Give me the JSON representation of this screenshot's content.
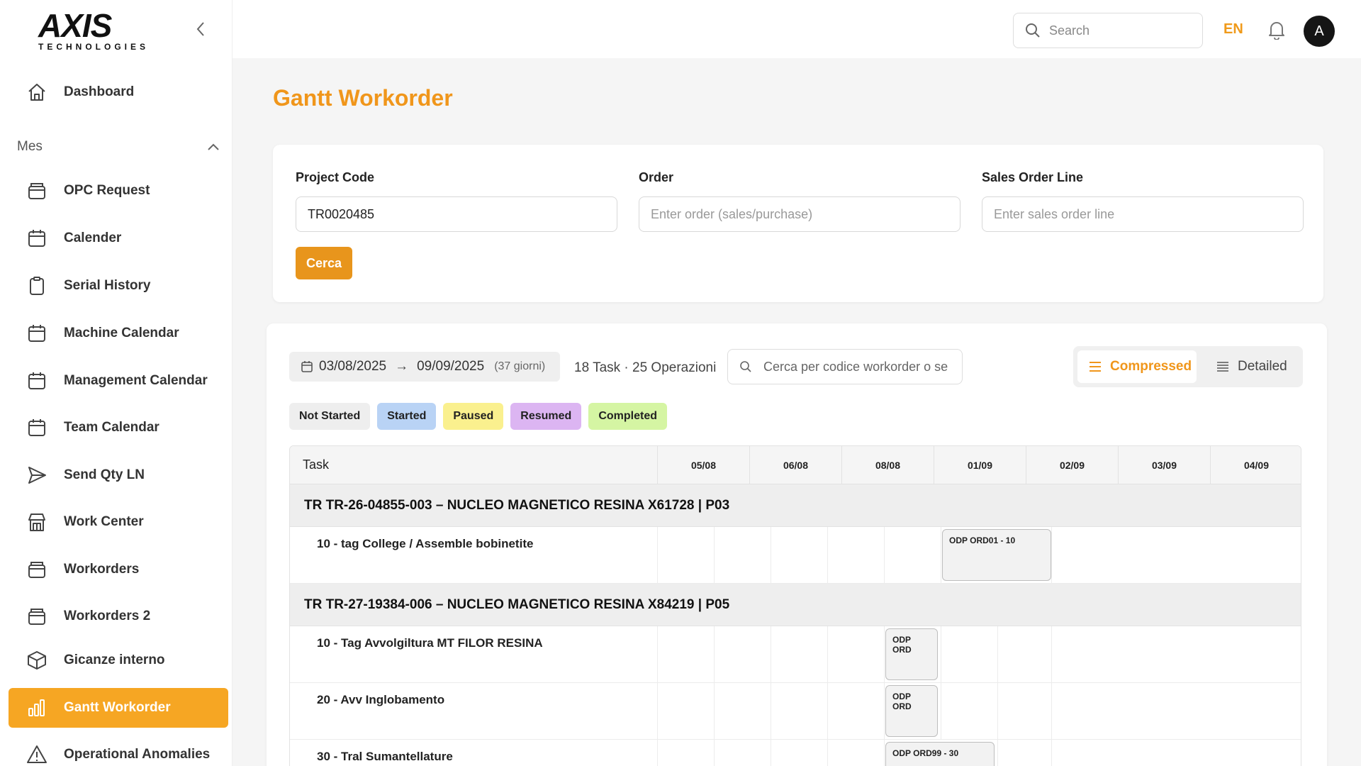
{
  "brand": {
    "name_main": "AXIS",
    "name_sub": "TECHNOLOGIES",
    "accent": "#f6a623",
    "logo_x_color": "#d32f2f"
  },
  "sidebar": {
    "dashboard": "Dashboard",
    "section": "Mes",
    "items": [
      {
        "label": "OPC Request",
        "icon": "box-icon"
      },
      {
        "label": "Calender",
        "icon": "calendar-icon"
      },
      {
        "label": "Serial History",
        "icon": "clipboard-icon"
      },
      {
        "label": "Machine Calendar",
        "icon": "calendar-icon"
      },
      {
        "label": "Management Calendar",
        "icon": "calendar-icon"
      },
      {
        "label": "Team Calendar",
        "icon": "calendar-icon"
      },
      {
        "label": "Send Qty LN",
        "icon": "send-icon"
      },
      {
        "label": "Work Center",
        "icon": "building-icon"
      },
      {
        "label": "Workorders",
        "icon": "box-icon"
      },
      {
        "label": "Workorders 2",
        "icon": "box-icon"
      },
      {
        "label": "Gicanze interno",
        "icon": "cube-icon"
      },
      {
        "label": "Gantt Workorder",
        "icon": "bar-chart-icon",
        "active": true
      },
      {
        "label": "Operational Anomalies",
        "icon": "warning-icon"
      }
    ]
  },
  "topbar": {
    "search_placeholder": "Search",
    "language": "EN",
    "avatar_initial": "A"
  },
  "page": {
    "title": "Gantt Workorder"
  },
  "filters": {
    "project_code_label": "Project Code",
    "project_code_value": "TR0020485",
    "order_label": "Order",
    "order_placeholder": "Enter order (sales/purchase)",
    "sales_line_label": "Sales Order Line",
    "sales_line_placeholder": "Enter sales order line",
    "search_button": "Cerca"
  },
  "gantt": {
    "date_from": "03/08/2025",
    "date_to": "09/09/2025",
    "duration": "(37 giorni)",
    "summary": "18 Task · 25 Operazioni",
    "search_placeholder": "Cerca per codice workorder o se",
    "view_compressed": "Compressed",
    "view_detailed": "Detailed",
    "legend": [
      {
        "label": "Not Started",
        "color": "#eeeeee"
      },
      {
        "label": "Started",
        "color": "#b9d3f5"
      },
      {
        "label": "Paused",
        "color": "#faf08e"
      },
      {
        "label": "Resumed",
        "color": "#dcb5f2"
      },
      {
        "label": "Completed",
        "color": "#d5f5a3"
      }
    ],
    "task_header": "Task",
    "dates": [
      "05/08",
      "06/08",
      "08/08",
      "01/09",
      "02/09",
      "03/09",
      "04/09"
    ],
    "groups": [
      {
        "title": "TR TR-26-04855-003 – NUCLEO MAGNETICO RESINA X61728 | P03",
        "tasks": [
          {
            "label": "10 - tag College / Assemble bobinetite",
            "bar": "ODP ORD01 - 10"
          }
        ]
      },
      {
        "title": "TR TR-27-19384-006 – NUCLEO MAGNETICO RESINA X84219 | P05",
        "tasks": [
          {
            "label": "10 - Tag Avvolgiltura MT FILOR RESINA",
            "bar": "ODP ORD"
          },
          {
            "label": "20 - Avv Inglobamento",
            "bar": "ODP ORD"
          },
          {
            "label": "30 - Tral Sumantellature",
            "bar": "ODP ORD99 - 30"
          }
        ]
      }
    ]
  }
}
